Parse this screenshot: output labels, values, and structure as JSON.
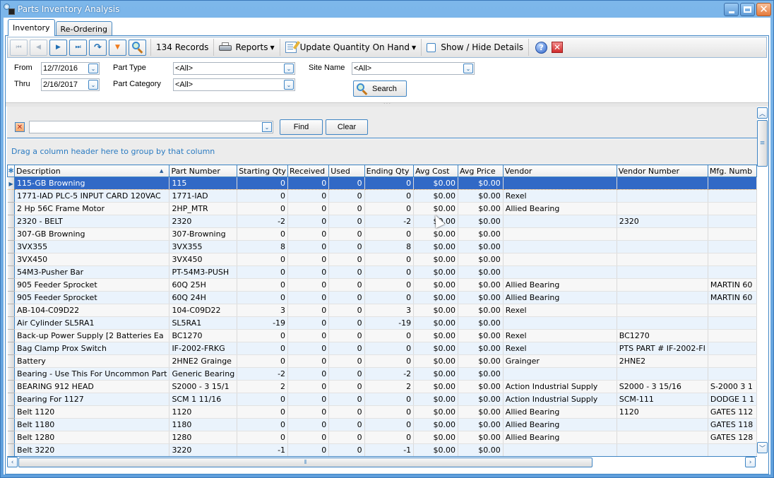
{
  "window": {
    "title": "Parts Inventory Analysis",
    "controls": [
      "minimize",
      "maximize",
      "close"
    ]
  },
  "tabs": [
    {
      "label": "Inventory",
      "active": true
    },
    {
      "label": "Re-Ordering",
      "active": false
    }
  ],
  "toolbar": {
    "nav_buttons": [
      {
        "name": "first-record",
        "icon": "⏮",
        "enabled": false
      },
      {
        "name": "previous-record",
        "icon": "◀",
        "enabled": false
      },
      {
        "name": "next-record",
        "icon": "▶",
        "enabled": true
      },
      {
        "name": "last-record",
        "icon": "⏭",
        "enabled": true
      },
      {
        "name": "refresh",
        "icon": "↷",
        "enabled": true
      },
      {
        "name": "filter",
        "icon": "▼",
        "enabled": true
      }
    ],
    "record_count": "134 Records",
    "reports_label": "Reports",
    "update_qty_label": "Update Quantity On Hand",
    "show_hide_label": "Show / Hide Details",
    "show_hide_checked": false,
    "help_icon": "?",
    "close_icon": "✕"
  },
  "filters": {
    "from_label": "From",
    "from_value": "12/7/2016",
    "thru_label": "Thru",
    "thru_value": "2/16/2017",
    "part_type_label": "Part Type",
    "part_type_value": "<All>",
    "part_category_label": "Part Category",
    "part_category_value": "<All>",
    "site_name_label": "Site Name",
    "site_name_value": "<All>",
    "search_label": "Search"
  },
  "find_panel": {
    "input_value": "",
    "find_label": "Find",
    "clear_label": "Clear"
  },
  "group_panel_text": "Drag a column header here to group by that column",
  "grid": {
    "sort_column": "Description",
    "sort_direction": "ascending",
    "columns": [
      "Description",
      "Part Number",
      "Starting Qty",
      "Received",
      "Used",
      "Ending Qty",
      "Avg Cost",
      "Avg Price",
      "Vendor",
      "Vendor Number",
      "Mfg. Numb"
    ],
    "selected_row": 0,
    "rows": [
      [
        "115-GB Browning",
        "115",
        "0",
        "0",
        "0",
        "0",
        "$0.00",
        "$0.00",
        "",
        "",
        ""
      ],
      [
        "1771-IAD PLC-5 INPUT CARD 120VAC",
        "1771-IAD",
        "0",
        "0",
        "0",
        "0",
        "$0.00",
        "$0.00",
        "Rexel",
        "",
        ""
      ],
      [
        "2 Hp 56C Frame Motor",
        "2HP_MTR",
        "0",
        "0",
        "0",
        "0",
        "$0.00",
        "$0.00",
        "Allied Bearing",
        "",
        ""
      ],
      [
        "2320 - BELT",
        "2320",
        "-2",
        "0",
        "0",
        "-2",
        "$0.00",
        "$0.00",
        "",
        "2320",
        ""
      ],
      [
        "307-GB Browning",
        "307-Browning",
        "0",
        "0",
        "0",
        "0",
        "$0.00",
        "$0.00",
        "",
        "",
        ""
      ],
      [
        "3VX355",
        "3VX355",
        "8",
        "0",
        "0",
        "8",
        "$0.00",
        "$0.00",
        "",
        "",
        ""
      ],
      [
        "3VX450",
        "3VX450",
        "0",
        "0",
        "0",
        "0",
        "$0.00",
        "$0.00",
        "",
        "",
        ""
      ],
      [
        "54M3-Pusher Bar",
        "PT-54M3-PUSH",
        "0",
        "0",
        "0",
        "0",
        "$0.00",
        "$0.00",
        "",
        "",
        ""
      ],
      [
        "905 Feeder Sprocket",
        "60Q 25H",
        "0",
        "0",
        "0",
        "0",
        "$0.00",
        "$0.00",
        "Allied Bearing",
        "",
        "MARTIN 60"
      ],
      [
        "905 Feeder Sprocket",
        "60Q 24H",
        "0",
        "0",
        "0",
        "0",
        "$0.00",
        "$0.00",
        "Allied Bearing",
        "",
        "MARTIN 60"
      ],
      [
        "AB-104-C09D22",
        "104-C09D22",
        "3",
        "0",
        "0",
        "3",
        "$0.00",
        "$0.00",
        "Rexel",
        "",
        ""
      ],
      [
        "Air Cylinder SL5RA1",
        "SL5RA1",
        "-19",
        "0",
        "0",
        "-19",
        "$0.00",
        "$0.00",
        "",
        "",
        ""
      ],
      [
        "Back-up Power Supply [2 Batteries Ea",
        "BC1270",
        "0",
        "0",
        "0",
        "0",
        "$0.00",
        "$0.00",
        "Rexel",
        "BC1270",
        ""
      ],
      [
        "Bag Clamp Prox Switch",
        "IF-2002-FRKG",
        "0",
        "0",
        "0",
        "0",
        "$0.00",
        "$0.00",
        "Rexel",
        "PTS PART # IF-2002-FI",
        ""
      ],
      [
        "Battery",
        "2HNE2 Grainge",
        "0",
        "0",
        "0",
        "0",
        "$0.00",
        "$0.00",
        "Grainger",
        "2HNE2",
        ""
      ],
      [
        "Bearing - Use This For Uncommon Part",
        "Generic Bearing",
        "-2",
        "0",
        "0",
        "-2",
        "$0.00",
        "$0.00",
        "",
        "",
        ""
      ],
      [
        "BEARING 912 HEAD",
        "S2000 - 3 15/1",
        "2",
        "0",
        "0",
        "2",
        "$0.00",
        "$0.00",
        "Action Industrial Supply",
        "S2000 - 3  15/16",
        "S-2000 3 1"
      ],
      [
        "Bearing For 1127",
        "SCM 1 11/16",
        "0",
        "0",
        "0",
        "0",
        "$0.00",
        "$0.00",
        "Action Industrial Supply",
        "SCM-111",
        "DODGE 1 1"
      ],
      [
        "Belt 1120",
        "1120",
        "0",
        "0",
        "0",
        "0",
        "$0.00",
        "$0.00",
        "Allied Bearing",
        "1120",
        "GATES 112"
      ],
      [
        "Belt 1180",
        "1180",
        "0",
        "0",
        "0",
        "0",
        "$0.00",
        "$0.00",
        "Allied Bearing",
        "",
        "GATES 118"
      ],
      [
        "Belt 1280",
        "1280",
        "0",
        "0",
        "0",
        "0",
        "$0.00",
        "$0.00",
        "Allied Bearing",
        "",
        "GATES 128"
      ],
      [
        "Belt 3220",
        "3220",
        "-1",
        "0",
        "0",
        "-1",
        "$0.00",
        "$0.00",
        "",
        "",
        ""
      ]
    ]
  },
  "colors": {
    "accent": "#3f85c4",
    "selection": "#3169c6",
    "group_text": "#2b7bc1"
  }
}
